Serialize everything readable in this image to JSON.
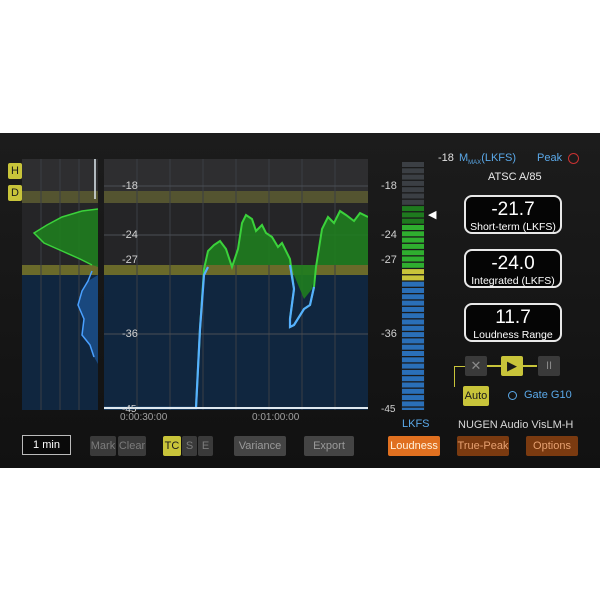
{
  "side_buttons": {
    "h": "H",
    "d": "D"
  },
  "timeline": {
    "left_scale": [
      "-18",
      "-24",
      "-27",
      "-36",
      "-45"
    ],
    "time_labels": [
      "0:00:30:00",
      "0:01:00:00"
    ],
    "time_window": "1 min"
  },
  "meter": {
    "scale": [
      "-18",
      "-24",
      "-27",
      "-36",
      "-45"
    ],
    "unit": "LKFS",
    "max_value": "-18",
    "max_label": "M",
    "max_sub": "MAX",
    "max_unit": "(LKFS)",
    "peak_label": "Peak",
    "target_level": -23
  },
  "standard": "ATSC A/85",
  "readouts": [
    {
      "value": "-21.7",
      "label": "Short-term (LKFS)"
    },
    {
      "value": "-24.0",
      "label": "Integrated (LKFS)"
    },
    {
      "value": "11.7",
      "label": "Loudness Range"
    }
  ],
  "transport": {
    "clear": "✕",
    "play": "▶",
    "pause": "II",
    "auto": "Auto",
    "gate": "Gate G10"
  },
  "product_name": "NUGEN Audio VisLM-H",
  "controls": {
    "mark": "Mark",
    "clear": "Clear",
    "tc": "TC",
    "s": "S",
    "e": "E",
    "variance": "Variance",
    "export": "Export"
  },
  "mode_buttons": {
    "loudness": "Loudness",
    "true_peak": "True-Peak",
    "options": "Options"
  },
  "colors": {
    "accent_yellow": "#c8c43a",
    "orange": "#e07020",
    "green": "#2fae2f",
    "blue": "#2a78c8"
  }
}
